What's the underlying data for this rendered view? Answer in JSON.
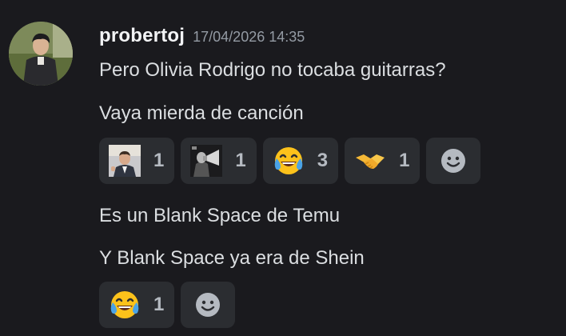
{
  "author": {
    "username": "probertoj",
    "timestamp": "17/04/2026 14:35",
    "avatar_icon": "user-photo-avatar"
  },
  "messages": [
    {
      "text": "Pero Olivia Rodrigo no tocaba guitarras?"
    },
    {
      "text": "Vaya mierda de canción"
    },
    {
      "text": "Es un Blank Space de Temu"
    },
    {
      "text": "Y Blank Space ya era de Shein"
    }
  ],
  "reactions_group_1": [
    {
      "emoji": "custom-emoji-man-in-suit",
      "count": "1"
    },
    {
      "emoji": "custom-emoji-megaphone-photo",
      "count": "1"
    },
    {
      "emoji": "joy-emoji",
      "count": "3"
    },
    {
      "emoji": "handshake-emoji",
      "count": "1"
    }
  ],
  "reactions_group_2": [
    {
      "emoji": "joy-emoji",
      "count": "1"
    }
  ],
  "add_reaction_icon": "add-reaction-smiley-icon",
  "colors": {
    "background": "#1a1a1e",
    "reaction_background": "#2b2d31",
    "username": "#f2f3f5",
    "timestamp": "#949ba4",
    "text": "#dbdee1"
  }
}
